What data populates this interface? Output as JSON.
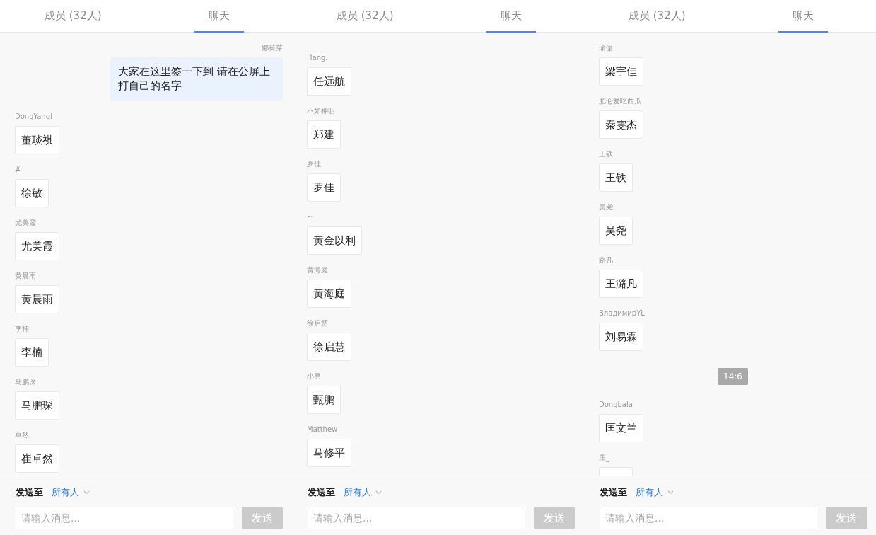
{
  "panels": [
    {
      "tabs": [
        {
          "label": "成员 (32人)",
          "selected": false
        },
        {
          "label": "聊天",
          "selected": true
        }
      ],
      "messages": [
        {
          "kind": "message",
          "mine": true,
          "sender": "娜荷芽",
          "text": "大家在这里签一下到 请在公屏上打自己的名字"
        },
        {
          "kind": "message",
          "mine": false,
          "sender": "DongYanqi",
          "text": "董琰祺"
        },
        {
          "kind": "message",
          "mine": false,
          "sender": "#",
          "text": "徐敏"
        },
        {
          "kind": "message",
          "mine": false,
          "sender": "尤美霞",
          "text": "尤美霞"
        },
        {
          "kind": "message",
          "mine": false,
          "sender": "黄晨雨",
          "text": "黄晨雨"
        },
        {
          "kind": "message",
          "mine": false,
          "sender": "李楠",
          "text": "李楠"
        },
        {
          "kind": "message",
          "mine": false,
          "sender": "马鹏琛",
          "text": "马鹏琛"
        },
        {
          "kind": "message",
          "mine": false,
          "sender": "卓然",
          "text": "崔卓然"
        }
      ],
      "composer": {
        "label": "发送至",
        "recipient": "所有人",
        "placeholder": "请输入消息...",
        "send": "发送"
      }
    },
    {
      "tabs": [
        {
          "label": "成员 (32人)",
          "selected": false
        },
        {
          "label": "聊天",
          "selected": true
        }
      ],
      "messages": [
        {
          "kind": "message",
          "mine": false,
          "sender": "Hang.",
          "text": "任远航"
        },
        {
          "kind": "message",
          "mine": false,
          "sender": "不如神明",
          "text": "郑建"
        },
        {
          "kind": "message",
          "mine": false,
          "sender": "罗佳",
          "text": "罗佳"
        },
        {
          "kind": "message",
          "mine": false,
          "sender": "~",
          "text": "黄金以利"
        },
        {
          "kind": "message",
          "mine": false,
          "sender": "黄海庭",
          "text": "黄海庭"
        },
        {
          "kind": "message",
          "mine": false,
          "sender": "徐启慧",
          "text": "徐启慧"
        },
        {
          "kind": "message",
          "mine": false,
          "sender": "小男",
          "text": "甄鹏"
        },
        {
          "kind": "message",
          "mine": false,
          "sender": "Matthew",
          "text": "马修平"
        }
      ],
      "composer": {
        "label": "发送至",
        "recipient": "所有人",
        "placeholder": "请输入消息...",
        "send": "发送"
      }
    },
    {
      "tabs": [
        {
          "label": "成员 (32人)",
          "selected": false
        },
        {
          "label": "聊天",
          "selected": true
        }
      ],
      "messages": [
        {
          "kind": "message",
          "mine": false,
          "sender": "瑜伽",
          "text": "梁宇佳"
        },
        {
          "kind": "message",
          "mine": false,
          "sender": "肥仑爱吃西瓜",
          "text": "秦雯杰"
        },
        {
          "kind": "message",
          "mine": false,
          "sender": "王铁",
          "text": "王铁"
        },
        {
          "kind": "message",
          "mine": false,
          "sender": "吴尧",
          "text": "吴尧"
        },
        {
          "kind": "message",
          "mine": false,
          "sender": "路凡",
          "text": "王潞凡"
        },
        {
          "kind": "message",
          "mine": false,
          "sender": "ВладимирYL",
          "text": "刘易霖"
        },
        {
          "kind": "time",
          "text": "14:6"
        },
        {
          "kind": "message",
          "mine": false,
          "sender": "Dongbala",
          "text": "匡文兰"
        },
        {
          "kind": "message",
          "mine": false,
          "sender": "庄_"
        }
      ],
      "composer": {
        "label": "发送至",
        "recipient": "所有人",
        "placeholder": "请输入消息...",
        "send": "发送"
      }
    }
  ]
}
